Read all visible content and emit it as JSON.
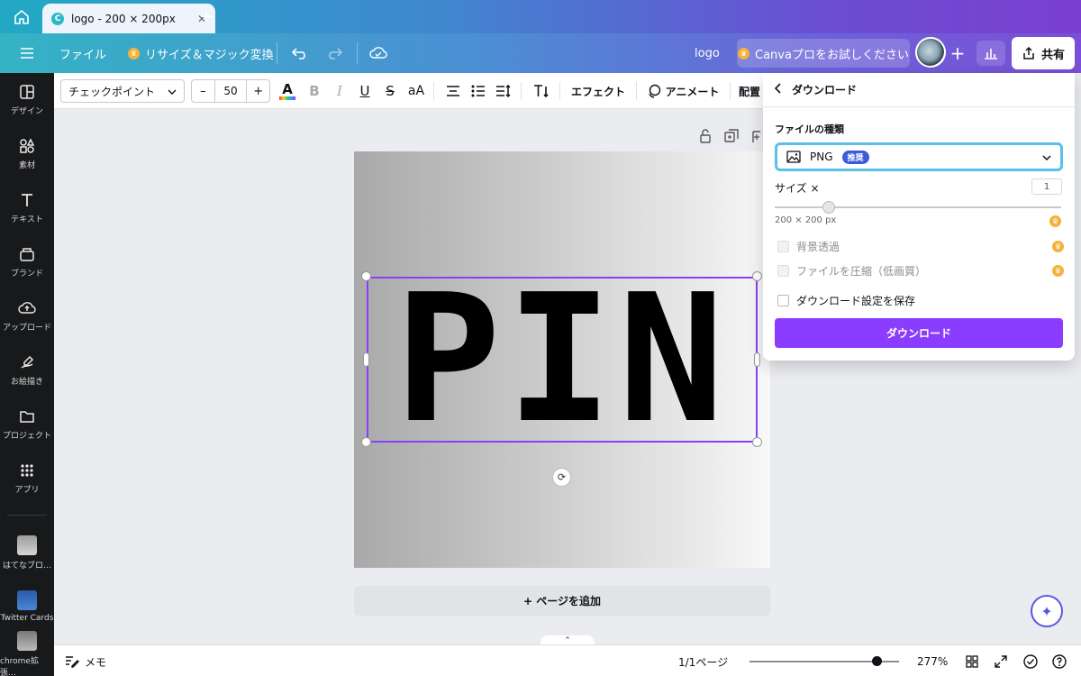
{
  "browser": {
    "tab_title": "logo - 200 × 200px",
    "close_symbol": "✕",
    "new_tab_symbol": "+"
  },
  "header": {
    "file_label": "ファイル",
    "resize_label": "リサイズ＆マジック変換",
    "doc_name": "logo",
    "try_pro_label": "Canvaプロをお試しください",
    "share_label": "共有",
    "add_symbol": "+"
  },
  "sidebar": {
    "items": [
      {
        "label": "デザイン",
        "icon": "layout-icon"
      },
      {
        "label": "素材",
        "icon": "elements-icon"
      },
      {
        "label": "テキスト",
        "icon": "text-icon"
      },
      {
        "label": "ブランド",
        "icon": "brand-icon"
      },
      {
        "label": "アップロード",
        "icon": "upload-icon"
      },
      {
        "label": "お絵描き",
        "icon": "draw-icon"
      },
      {
        "label": "プロジェクト",
        "icon": "folder-icon"
      },
      {
        "label": "アプリ",
        "icon": "apps-icon"
      },
      {
        "label": "はてなブロ…",
        "icon": "app-thumb"
      },
      {
        "label": "Twitter Cards",
        "icon": "app-thumb"
      },
      {
        "label": "chrome拡張…",
        "icon": "app-thumb"
      }
    ]
  },
  "toolbar": {
    "font_name": "チェックポイント",
    "font_size": "50",
    "minus": "–",
    "plus": "+",
    "bold": "B",
    "italic": "I",
    "underline": "U",
    "strike": "S",
    "case": "aA",
    "effects_label": "エフェクト",
    "animate_label": "アニメート",
    "position_label": "配置"
  },
  "canvas": {
    "logo_text": "PIN",
    "add_page_label": "+ ページを追加"
  },
  "footer": {
    "notes_label": "メモ",
    "page_indicator": "1/1ページ",
    "zoom_label": "277%",
    "zoom_level": 0.85
  },
  "download_panel": {
    "title": "ダウンロード",
    "file_type_heading": "ファイルの種類",
    "file_type_value": "PNG",
    "recommended_badge": "推奨",
    "size_label": "サイズ ×",
    "size_value": "1",
    "size_pixels": "200 × 200 px",
    "transparent_bg_label": "背景透過",
    "compress_label": "ファイルを圧縮（低画質）",
    "save_settings_label": "ダウンロード設定を保存",
    "download_button": "ダウンロード"
  },
  "colors": {
    "accent": "#8b3dff",
    "focus_ring": "#58c1eb",
    "badge": "#3b5bdb",
    "sidebar": "#18191b",
    "pro_crown": "#f5b23a"
  }
}
